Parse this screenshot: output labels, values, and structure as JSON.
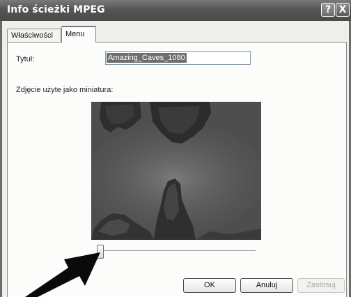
{
  "window": {
    "title": "Info ścieżki MPEG",
    "help_label": "?",
    "close_label": "X"
  },
  "tabs": [
    {
      "label": "Właściwości",
      "selected": false
    },
    {
      "label": "Menu",
      "selected": true
    }
  ],
  "form": {
    "title_label": "Tytuł:",
    "title_value": "Amazing_Caves_1080",
    "thumbnail_label": "Zdjęcie użyte jako miniatura:"
  },
  "slider": {
    "position": 0.0
  },
  "buttons": {
    "ok": "OK",
    "cancel": "Anuluj",
    "apply": "Zastosuj"
  },
  "colors": {
    "titlebar": "#555555",
    "apply_disabled_text": "#a8a8a8"
  }
}
